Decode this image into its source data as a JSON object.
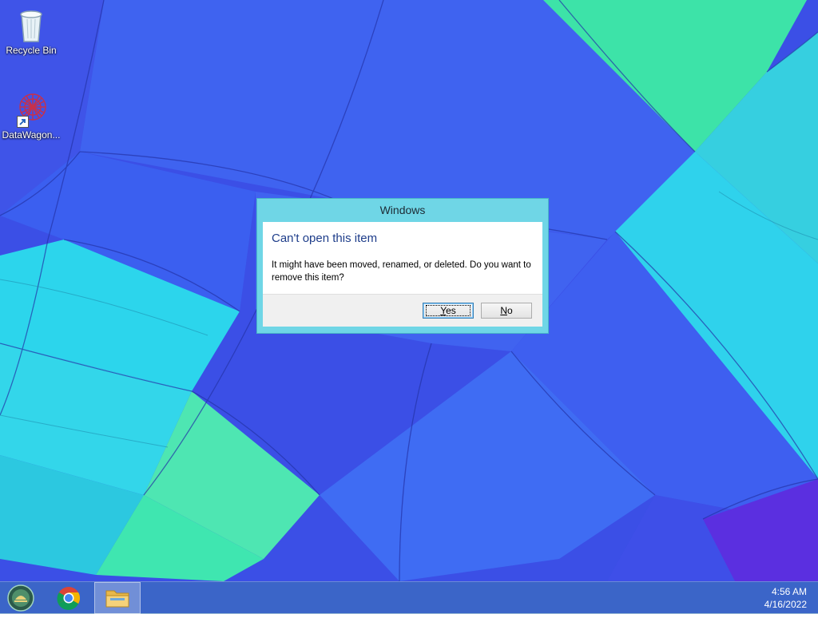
{
  "desktop": {
    "icons": [
      {
        "label": "Recycle Bin",
        "icon": "recycle-bin-icon"
      },
      {
        "label": "DataWagon...",
        "icon": "datawagon-icon"
      }
    ]
  },
  "dialog": {
    "title": "Windows",
    "heading": "Can't open this item",
    "message": "It might have been moved, renamed, or deleted. Do you want to remove this item?",
    "buttons": {
      "yes": {
        "label_mnemonic": "Y",
        "label_rest": "es"
      },
      "no": {
        "label_mnemonic": "N",
        "label_rest": "o"
      }
    },
    "colors": {
      "frame": "#6fd6e6",
      "heading": "#1e3d8a"
    }
  },
  "taskbar": {
    "items": [
      {
        "icon": "start-orb-icon"
      },
      {
        "icon": "chrome-icon"
      },
      {
        "icon": "file-explorer-icon"
      }
    ],
    "clock": {
      "time": "4:56 AM",
      "date": "4/16/2022"
    }
  }
}
